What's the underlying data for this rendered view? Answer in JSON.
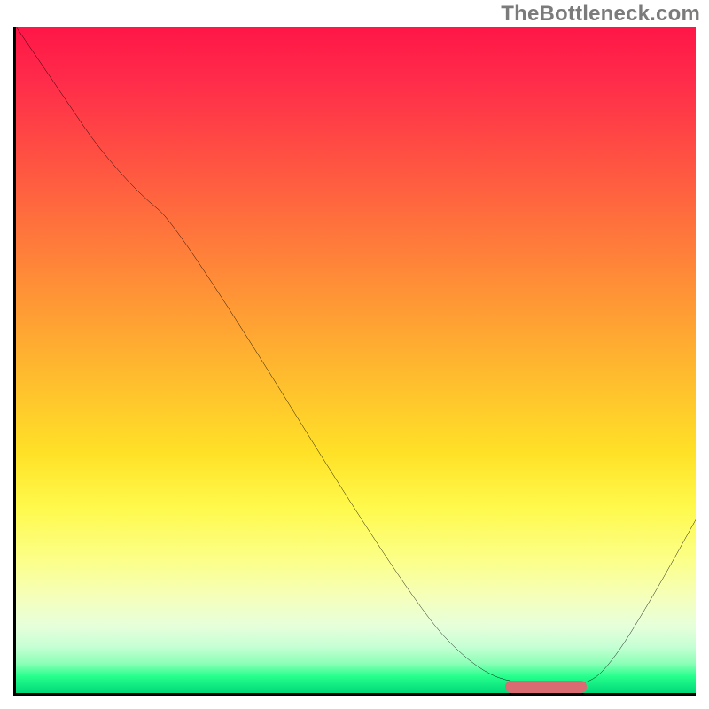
{
  "watermark": "TheBottleneck.com",
  "chart_data": {
    "type": "line",
    "title": "",
    "xlabel": "",
    "ylabel": "",
    "xlim": [
      0,
      100
    ],
    "ylim": [
      0,
      100
    ],
    "grid": false,
    "series": [
      {
        "name": "bottleneck-curve",
        "x": [
          0,
          8,
          12,
          18,
          24,
          58,
          68,
          76,
          84,
          88,
          94,
          100
        ],
        "values": [
          100,
          88,
          82,
          75,
          70,
          14,
          3,
          1,
          1,
          5,
          15,
          26
        ]
      }
    ],
    "annotations": [
      {
        "name": "optimal-marker",
        "shape": "pill",
        "color": "#db6b72",
        "x_start": 72,
        "x_end": 84,
        "y": 0.5
      }
    ],
    "background_gradient": {
      "orientation": "vertical",
      "stops": [
        {
          "pos": 0.0,
          "color": "#ff1647"
        },
        {
          "pos": 0.5,
          "color": "#ffad31"
        },
        {
          "pos": 0.75,
          "color": "#fff94b"
        },
        {
          "pos": 0.93,
          "color": "#c6ffd4"
        },
        {
          "pos": 1.0,
          "color": "#00d878"
        }
      ]
    }
  }
}
